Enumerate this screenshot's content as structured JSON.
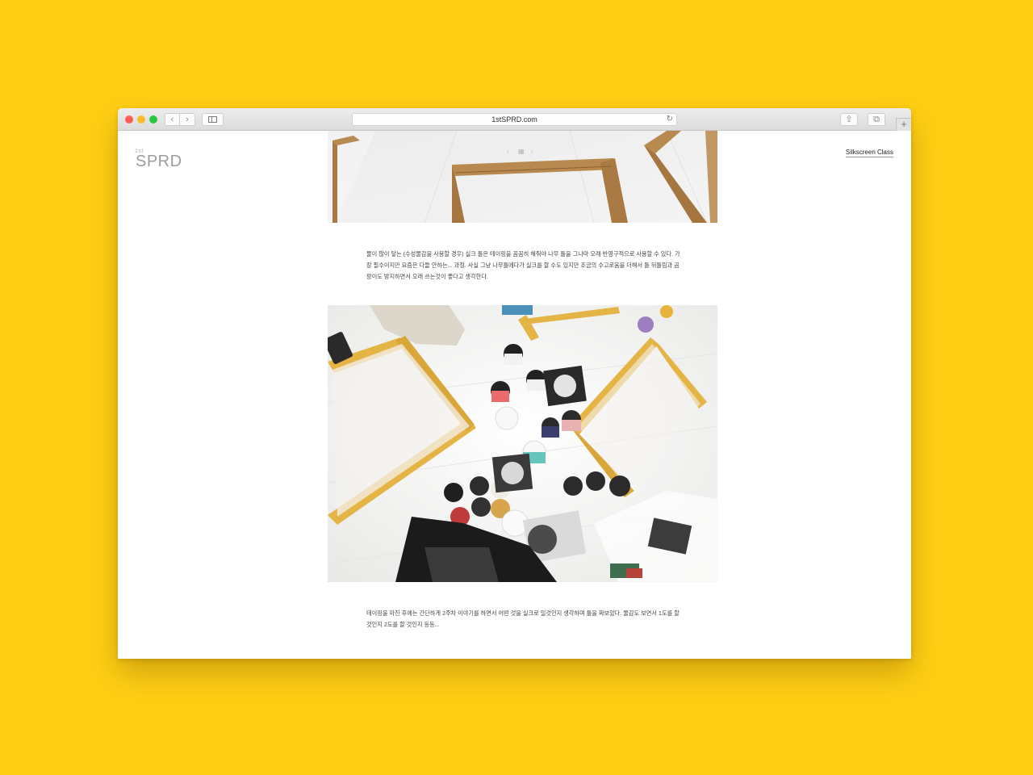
{
  "browser": {
    "url": "1stSPRD.com",
    "back_glyph": "‹",
    "forward_glyph": "›",
    "reload_glyph": "↻",
    "share_glyph": "⇪",
    "tabs_glyph": "⧉",
    "newtab_glyph": "+"
  },
  "site": {
    "logo_sup": "1st",
    "logo_main": "SPRD",
    "menu_link": "Silkscreen Class"
  },
  "gallery": {
    "nav_prev": "‹",
    "nav_grid": "▦",
    "nav_next": "›"
  },
  "article": {
    "paragraph1": "물이 많이 닿는 (수성물감을 사용할 경우) 실크 틀은 테이핑을 꼼꼼히 해줘야 나무 틀을 그나마 오래 반영구적으로 사용할 수 있다. 가장 필수이지만 요즘은 다들 안하는... 과정. 사실 그냥 나무틀에다가 실크를 할 수도 있지만 조금의 수고로움을 더해서 틀 뒤틀림과 곰팡이도 방지하면서 오래 쓰는것이 좋다고 생각한다.",
    "paragraph2": "테이핑을 마친 후에는 간단하게 2주차 이야기를 하면서 어떤 것을 실크로 밀것인지 생각하며 틀을 짜보았다. 물감도 보면서 1도를 할 것인지 2도를 할 것인지 등등..."
  },
  "colors": {
    "background": "#ffcf14",
    "window": "#ffffff",
    "frame_wood": "#b88a50",
    "frame_yellow": "#e4b445"
  },
  "icons": [
    "close-dot",
    "minimize-dot",
    "zoom-dot",
    "back-icon",
    "forward-icon",
    "sidebar-icon",
    "reload-icon",
    "share-icon",
    "tabs-icon",
    "new-tab-icon"
  ]
}
